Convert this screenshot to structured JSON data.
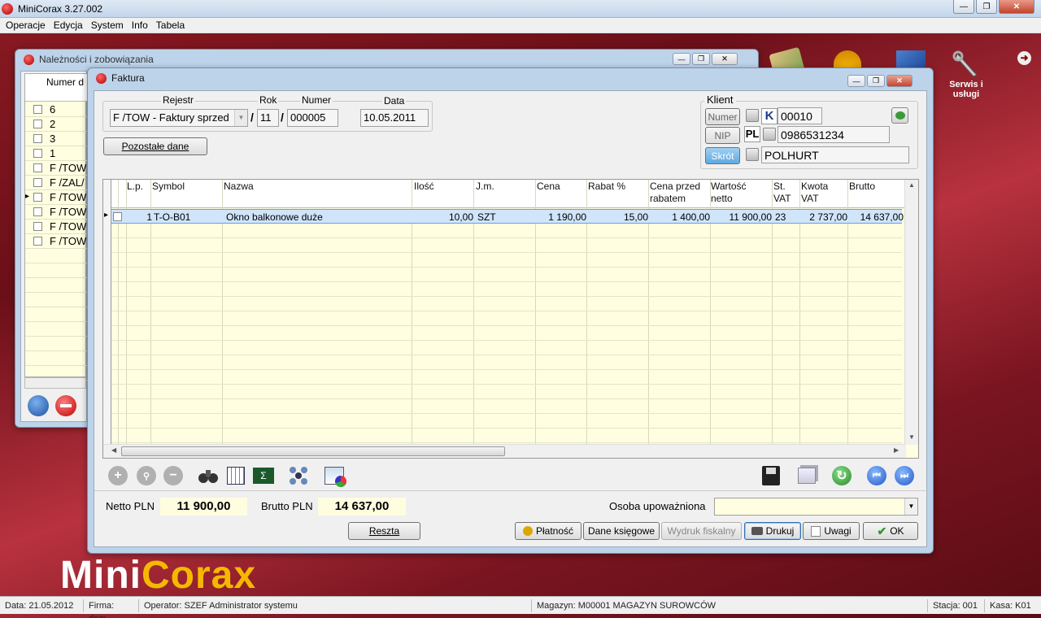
{
  "app": {
    "title": "MiniCorax 3.27.002"
  },
  "menu": [
    "Operacje",
    "Edycja",
    "System",
    "Info",
    "Tabela"
  ],
  "shortcuts": {
    "serwis_label": "Serwis i usługi"
  },
  "brand": {
    "mini": "Mini",
    "corax": "Corax"
  },
  "status": {
    "data": "Data: 21.05.2012",
    "firma": "Firma: dem",
    "operator": "Operator: SZEF Administrator systemu",
    "magazyn": "Magazyn: M00001 MAGAZYN SUROWCÓW",
    "stacja": "Stacja: 001",
    "kasa": "Kasa: K01"
  },
  "back_window": {
    "title": "Należności i zobowiązania",
    "column_header": "Numer d",
    "rows": [
      "6",
      "2",
      "3",
      "1",
      "F /TOW",
      "F /ZAL/",
      "F /TOW",
      "F /TOW",
      "F /TOW",
      "F /TOW"
    ]
  },
  "invoice": {
    "title": "Faktura",
    "labels": {
      "rejestr": "Rejestr",
      "rok": "Rok",
      "numer": "Numer",
      "data": "Data",
      "klient": "Klient"
    },
    "rejestr_value": "F /TOW - Faktury sprzed",
    "rok_value": "11",
    "numer_value": "000005",
    "data_value": "10.05.2011",
    "pozostale_button": "Pozostałe dane",
    "client": {
      "numer_btn": "Numer",
      "nip_btn": "NIP",
      "skrot_btn": "Skrót",
      "k_badge": "K",
      "pl_badge": "PL",
      "numer_value": "00010",
      "nip_value": "0986531234",
      "skrot_value": "POLHURT"
    },
    "grid": {
      "headers": [
        "L.p.",
        "Symbol",
        "Nazwa",
        "Ilość",
        "J.m.",
        "Cena",
        "Rabat %",
        "Cena przed rabatem",
        "Wartość netto",
        "St. VAT",
        "Kwota VAT",
        "Brutto"
      ],
      "rows": [
        {
          "lp": "1",
          "symbol": "T-O-B01",
          "nazwa": "Okno balkonowe duże",
          "ilosc": "10,00",
          "jm": "SZT",
          "cena": "1 190,00",
          "rabat": "15,00",
          "cena_przed": "1 400,00",
          "wartosc_netto": "11 900,00",
          "st_vat": "23",
          "kwota_vat": "2 737,00",
          "brutto": "14 637,00"
        }
      ]
    },
    "totals": {
      "netto_label": "Netto PLN",
      "netto_value": "11 900,00",
      "brutto_label": "Brutto PLN",
      "brutto_value": "14 637,00"
    },
    "osoba_label": "Osoba upoważniona",
    "osoba_value": "",
    "buttons": {
      "reszta": "Reszta",
      "platnosc": "Płatność",
      "dane_ksiegowe": "Dane księgowe",
      "wydruk_fiskalny": "Wydruk fiskalny",
      "drukuj": "Drukuj",
      "uwagi": "Uwagi",
      "ok": "OK"
    }
  }
}
